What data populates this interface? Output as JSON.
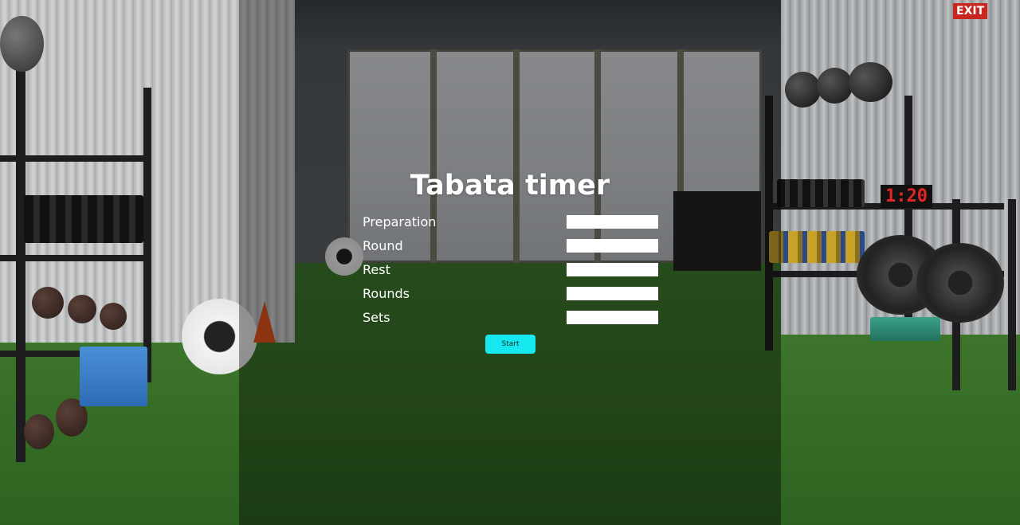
{
  "page": {
    "title": "Tabata timer"
  },
  "background": {
    "description_icon": "gym-photo-background",
    "exit_sign": "EXIT",
    "clock_display": "1:20"
  },
  "form": {
    "fields": [
      {
        "label": "Preparation",
        "value": ""
      },
      {
        "label": "Round",
        "value": ""
      },
      {
        "label": "Rest",
        "value": ""
      },
      {
        "label": "Rounds",
        "value": ""
      },
      {
        "label": "Sets",
        "value": ""
      }
    ]
  },
  "actions": {
    "start_label": "Start"
  },
  "colors": {
    "accent": "#15e8ee",
    "text": "#ffffff",
    "overlay": "rgba(0,0,0,0.38)"
  }
}
